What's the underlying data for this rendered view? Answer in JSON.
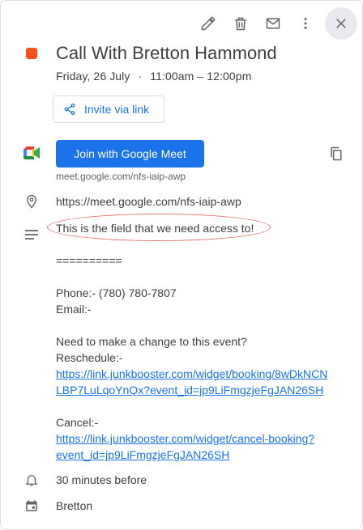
{
  "toolbar": {
    "icons": [
      "pencil-icon",
      "trash-icon",
      "mail-icon",
      "more-vert-icon",
      "close-icon"
    ]
  },
  "event": {
    "color": "#f4511e",
    "title": "Call With Bretton Hammond",
    "date": "Friday, 26 July",
    "separator": "·",
    "time": "11:00am – 12:00pm"
  },
  "invite": {
    "label": "Invite via link"
  },
  "meet": {
    "join_label": "Join with Google Meet",
    "url": "meet.google.com/nfs-iaip-awp"
  },
  "location": "https://meet.google.com/nfs-iaip-awp",
  "description": {
    "highlighted": "This is the field that we need access to!",
    "divider": "==========",
    "phone": "Phone:- (780) 780-7807",
    "email": "Email:-",
    "change_prompt": "Need to make a change to this event?",
    "reschedule_label": "Reschedule:-",
    "reschedule_link_1": "https://link.junkbooster.com/widget/booking/8wDkNCN",
    "reschedule_link_2": "LBP7LuLqoYnQx?event_id=jp9LiFmgzjeFgJAN26SH",
    "cancel_label": "Cancel:-",
    "cancel_link_1": "https://link.junkbooster.com/widget/cancel-booking?",
    "cancel_link_2": "event_id=jp9LiFmgzjeFgJAN26SH"
  },
  "reminder": "30 minutes before",
  "calendar": "Bretton",
  "colors": {
    "accent": "#1a73e8",
    "annotation": "#e0766d"
  }
}
